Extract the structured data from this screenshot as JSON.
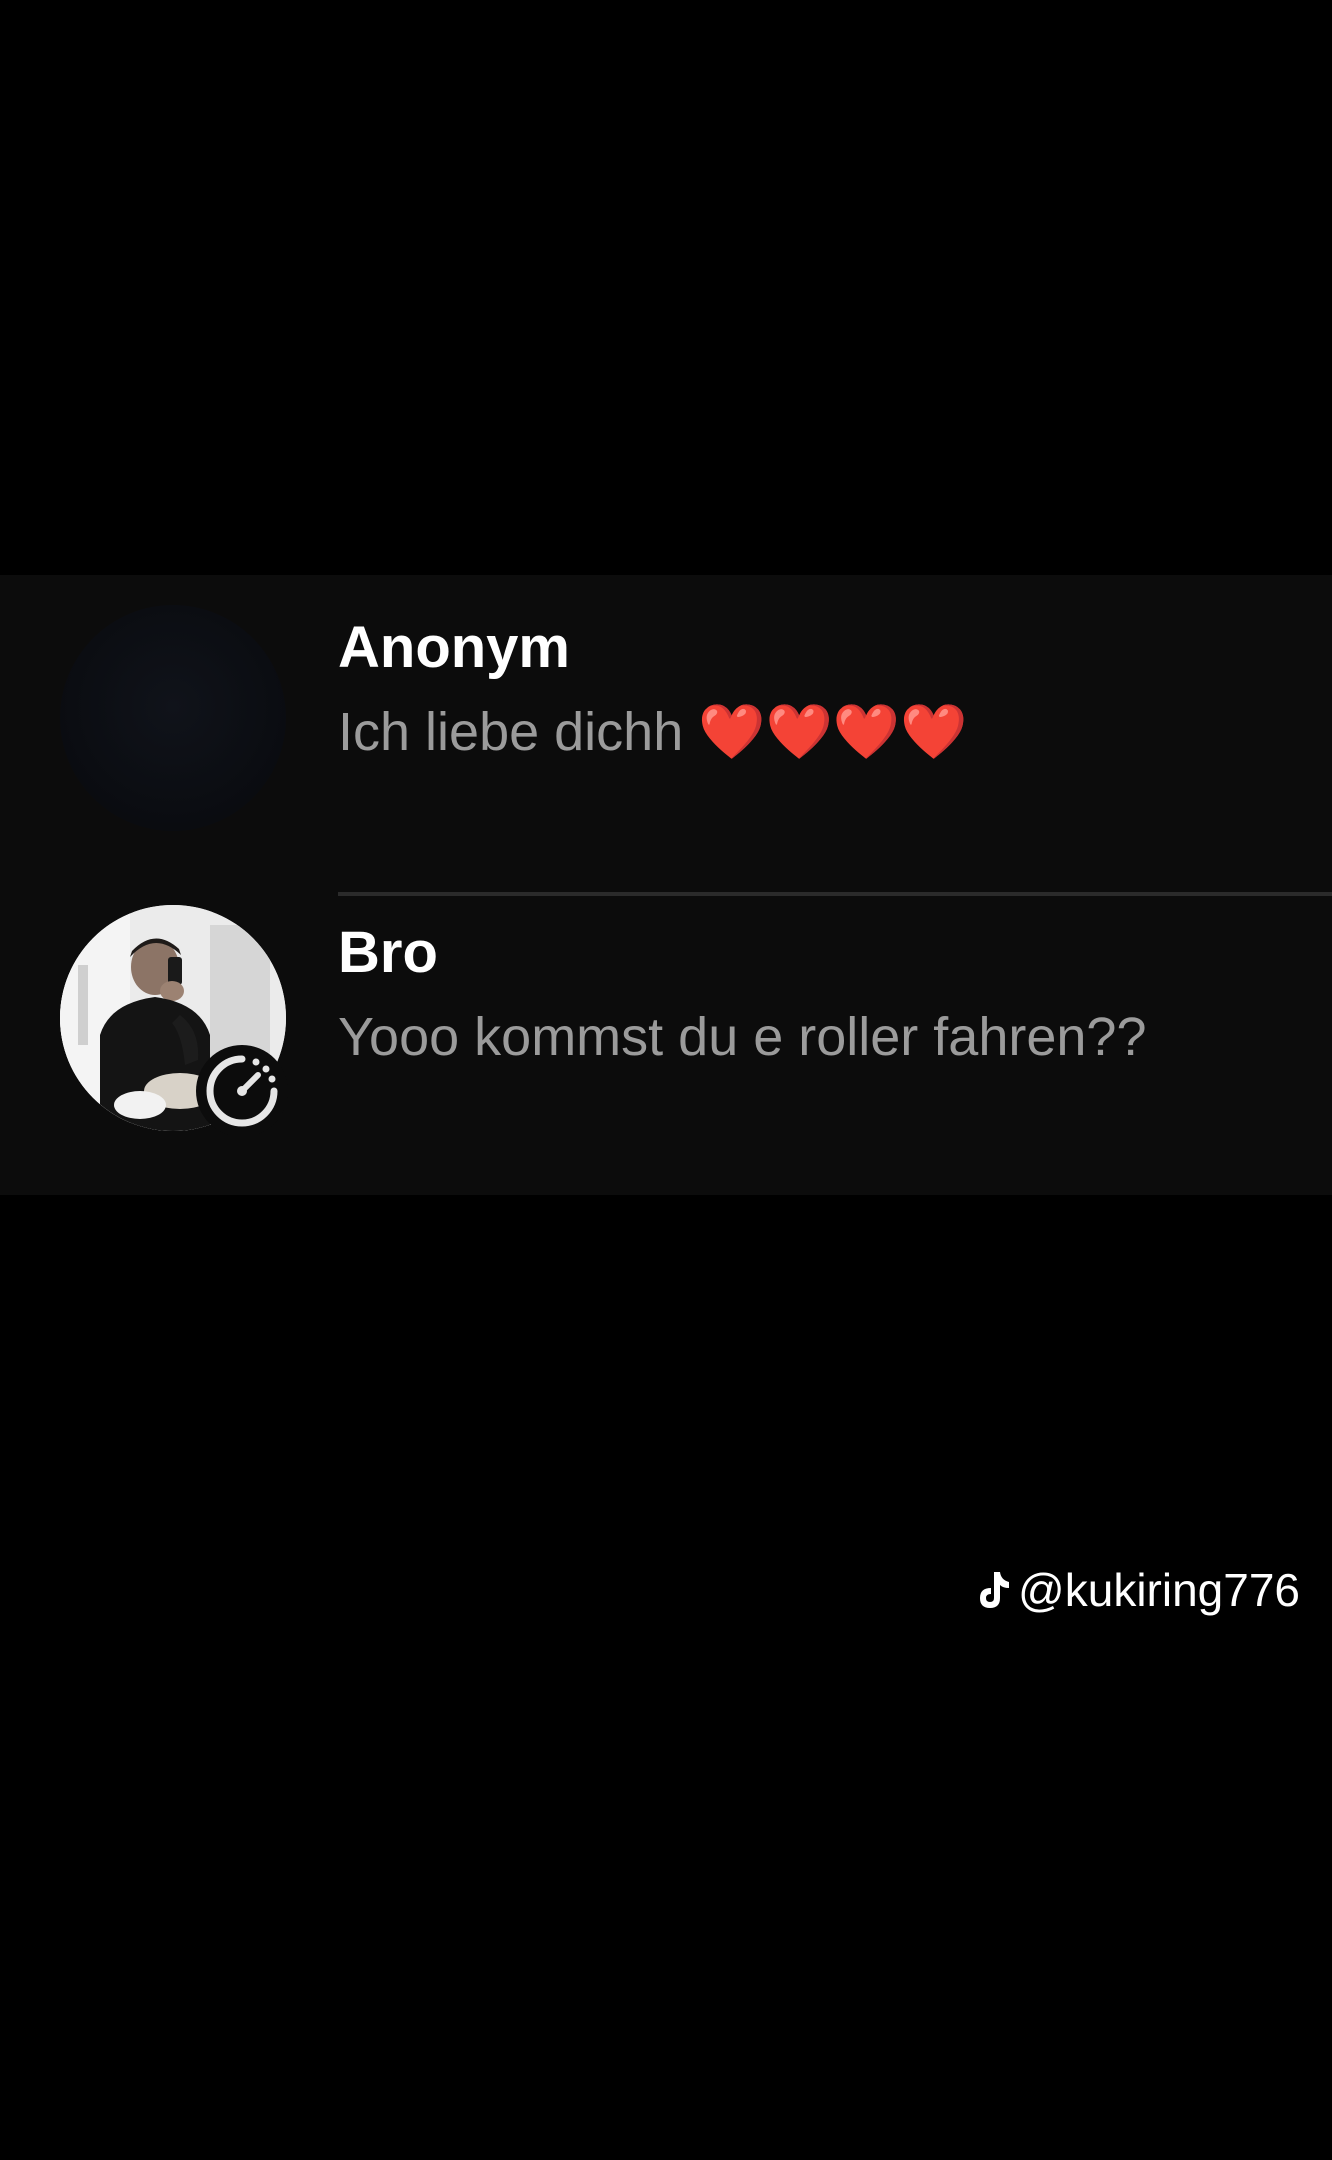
{
  "conversations": [
    {
      "name": "Anonym",
      "preview": "Ich liebe dichh ❤️❤️❤️❤️",
      "avatar_icon": "blank-avatar",
      "has_status_badge": false
    },
    {
      "name": "Bro",
      "preview": "Yooo kommst du e roller fahren??",
      "avatar_icon": "profile-photo",
      "has_status_badge": true,
      "status_icon": "speedometer-icon"
    }
  ],
  "watermark": {
    "handle": "@kukiring776",
    "logo": "tiktok-logo"
  },
  "colors": {
    "background": "#000000",
    "panel": "#0c0c0c",
    "name_text": "#ffffff",
    "preview_text": "#9b9b9b",
    "divider": "#2b2b2b"
  }
}
